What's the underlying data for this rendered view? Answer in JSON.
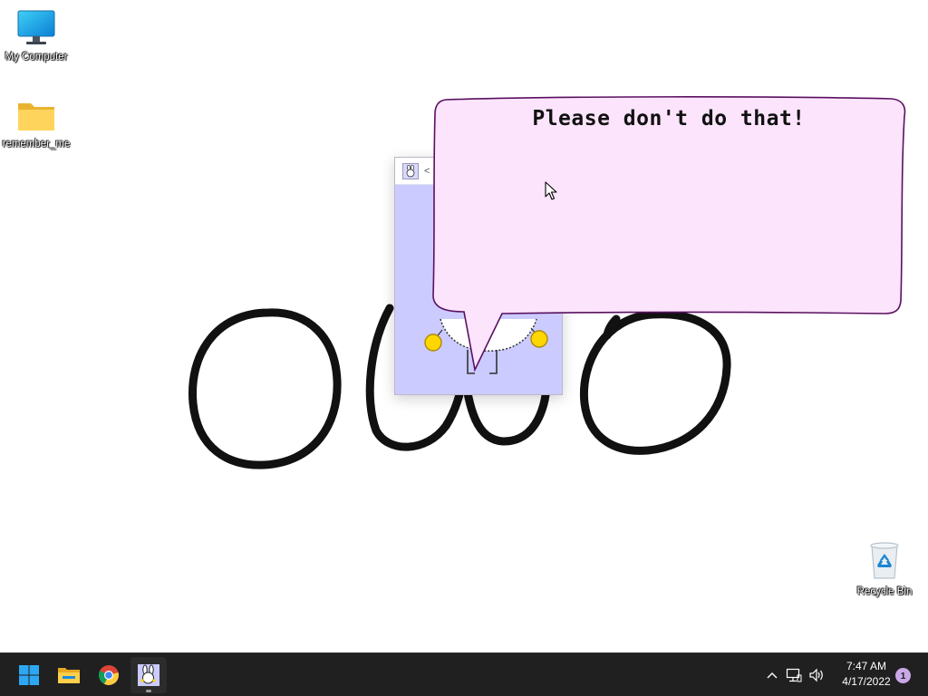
{
  "desktop": {
    "icons": [
      {
        "label": "My Computer",
        "icon": "monitor-icon"
      },
      {
        "label": "remember_me",
        "icon": "folder-icon"
      },
      {
        "label": "Recycle Bin",
        "icon": "recycle-bin-icon"
      }
    ],
    "drawing_icon": "owo-face-drawing"
  },
  "buddy_window": {
    "title": "<",
    "icon": "bunny-icon",
    "sprite": "bunny-character"
  },
  "speech_bubble": {
    "text": "Please don't do that!",
    "fill": "#fce4fc",
    "stroke": "#5a1060"
  },
  "taskbar": {
    "apps": [
      {
        "name": "Start",
        "icon": "windows-logo-icon"
      },
      {
        "name": "File Explorer",
        "icon": "folder-icon"
      },
      {
        "name": "Google Chrome",
        "icon": "chrome-icon"
      },
      {
        "name": "Desktop Buddy",
        "icon": "bunny-icon"
      }
    ],
    "tray": {
      "chevron_icon": "chevron-up-icon",
      "network_icon": "network-icon",
      "volume_icon": "speaker-icon",
      "time": "7:47 AM",
      "date": "4/17/2022",
      "notification_count": "1"
    }
  },
  "colors": {
    "taskbar_bg": "#202020",
    "window_bg": "#cbcbff",
    "accent_blue": "#0078d4",
    "notification_badge": "#c9a8e8"
  }
}
